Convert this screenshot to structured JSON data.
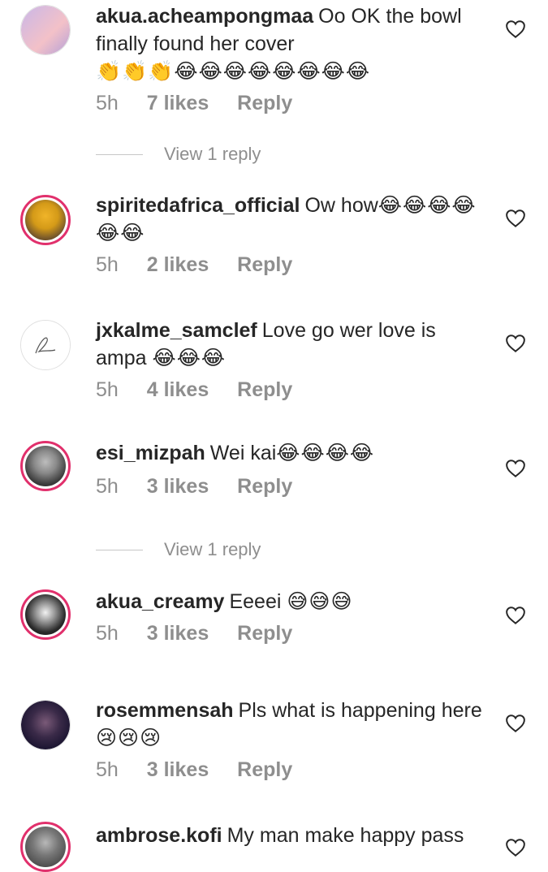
{
  "comments": [
    {
      "username": "akua.acheampongmaa",
      "text": "Oo OK the bowl finally found  her cover",
      "emoji": "👏👏👏😂😂😂😂😂😂😂😂",
      "time": "5h",
      "likes": "7 likes",
      "reply": "Reply"
    },
    {
      "username": "spiritedafrica_official",
      "text": "Ow how",
      "emoji": "😂😂😂😂😂😂",
      "time": "5h",
      "likes": "2 likes",
      "reply": "Reply"
    },
    {
      "username": "jxkalme_samclef",
      "text": "Love go wer love is ampa",
      "emoji": "😂😂😂",
      "time": "5h",
      "likes": "4 likes",
      "reply": "Reply"
    },
    {
      "username": "esi_mizpah",
      "text": "Wei kai",
      "emoji": "😂😂😂😂",
      "time": "5h",
      "likes": "3 likes",
      "reply": "Reply"
    },
    {
      "username": "akua_creamy",
      "text": "Eeeei",
      "emoji": "😅😅😅",
      "time": "5h",
      "likes": "3 likes",
      "reply": "Reply"
    },
    {
      "username": "rosemmensah",
      "text": "Pls what is happening here",
      "emoji": "😢😢😢",
      "time": "5h",
      "likes": "3 likes",
      "reply": "Reply"
    },
    {
      "username": "ambrose.kofi",
      "text": "My man make happy pass",
      "emoji": "",
      "time": "",
      "likes": "",
      "reply": ""
    }
  ],
  "view_replies": [
    "View 1 reply",
    "View 1 reply"
  ],
  "colors": {
    "username": "#262626",
    "meta": "#8e8e8e",
    "story_ring": "#e1306c"
  }
}
